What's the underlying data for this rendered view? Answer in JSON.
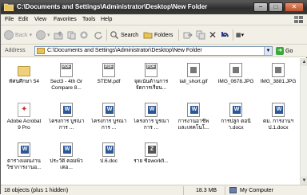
{
  "window": {
    "title": "C:\\Documents and Settings\\Administrator\\Desktop\\New Folder",
    "min_glyph": "–",
    "max_glyph": "□",
    "close_glyph": "✕"
  },
  "menu": [
    "File",
    "Edit",
    "View",
    "Favorites",
    "Tools",
    "Help"
  ],
  "toolbar": {
    "back": "Back",
    "forward": "",
    "search": "Search",
    "folders": "Folders",
    "views_glyph": "▦▾"
  },
  "address": {
    "label": "Address",
    "value": "C:\\Documents and Settings\\Administrator\\Desktop\\New Folder",
    "go": "Go"
  },
  "files": [
    {
      "name": "ทัศนศึกษา 54",
      "type": "folder"
    },
    {
      "name": "Sect3 - 4th Gr Compare 8...",
      "type": "pdf"
    },
    {
      "name": "STEM.pdf",
      "type": "pdf"
    },
    {
      "name": "จุดเน้นด้านการจัดการเรียน...",
      "type": "pdf"
    },
    {
      "name": "tall_short.gif",
      "type": "image"
    },
    {
      "name": "IMG_0678.JPG",
      "type": "image"
    },
    {
      "name": "IMG_3881.JPG",
      "type": "image"
    },
    {
      "name": "Adobe Acrobat 9 Pro",
      "type": "acrobat"
    },
    {
      "name": "โครงการ บูรณาการ ...",
      "type": "doc"
    },
    {
      "name": "โครงการ บูรณาการ ...",
      "type": "doc"
    },
    {
      "name": "โครงการ บูรณาการ ...",
      "type": "doc"
    },
    {
      "name": "การงานอาชีพ และเทคโนโ...",
      "type": "doc"
    },
    {
      "name": "การปลูก ดอนีา.docx",
      "type": "doc"
    },
    {
      "name": "คม. การงานฯ ป.1.docx",
      "type": "doc"
    },
    {
      "name": "ตารางแผนงาน วิชาการงานอ...",
      "type": "doc"
    },
    {
      "name": "ประวัติ คอมพิวเตอ...",
      "type": "doc"
    },
    {
      "name": "ป.6.doc",
      "type": "doc"
    },
    {
      "name": "ราย ชื่อworkfl...",
      "type": "zip"
    }
  ],
  "status": {
    "objects": "18 objects (plus 1 hidden)",
    "size": "18.3 MB",
    "location": "My Computer"
  },
  "colors": {
    "titlebar": "#3a3a3a",
    "chrome": "#f1efe6",
    "close": "#c0522a"
  }
}
